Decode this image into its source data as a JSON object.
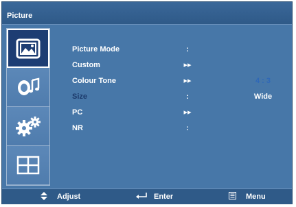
{
  "window": {
    "title": "Picture"
  },
  "icons": {
    "tabs": [
      "picture-icon",
      "sound-icon",
      "setup-icon",
      "layout-icon"
    ],
    "footer": [
      "up-down-arrows-icon",
      "enter-icon",
      "menu-icon"
    ]
  },
  "menu": {
    "items": [
      {
        "label": "Picture Mode",
        "separator": ":",
        "value": ""
      },
      {
        "label": "Custom",
        "separator": "▸▸",
        "value": ""
      },
      {
        "label": "Colour Tone",
        "separator": "▸▸",
        "value": "4 : 3"
      },
      {
        "label": "Size",
        "separator": ":",
        "value": "Wide"
      },
      {
        "label": "PC",
        "separator": "▸▸",
        "value": ""
      },
      {
        "label": "NR",
        "separator": ":",
        "value": ""
      }
    ]
  },
  "footer": {
    "adjust_label": "Adjust",
    "enter_label": "Enter",
    "menu_label": "Menu"
  },
  "colors": {
    "panel": "#4777a8",
    "title_bar": "#2f5a88",
    "active_tab": "#1d3d73",
    "text": "#ffffff",
    "disabled_text": "#1c3a6b",
    "highlight_value": "#2f68b8"
  }
}
